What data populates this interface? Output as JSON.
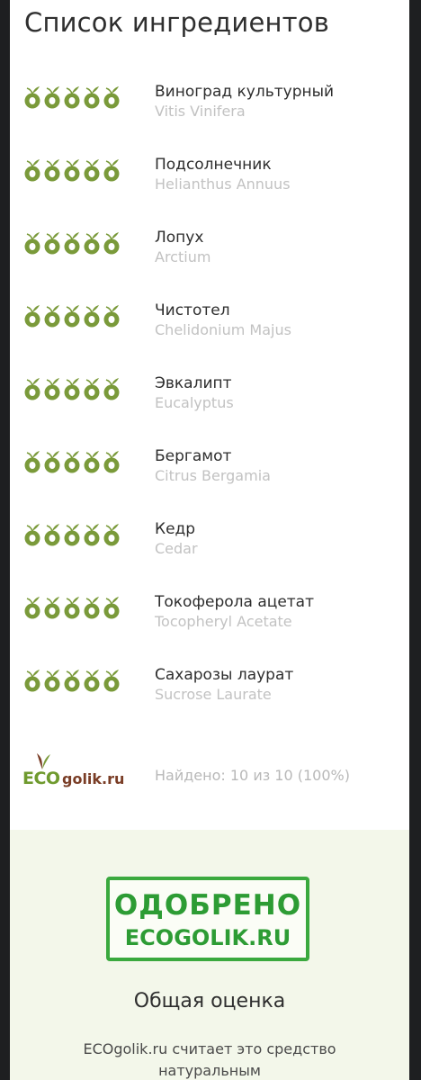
{
  "page": {
    "title": "Список ингредиентов"
  },
  "colors": {
    "accent_green": "#7a9a3a",
    "approve_green": "#2d9c34",
    "muted_gray": "#c2c2c2",
    "approve_bg": "#f3f7ea"
  },
  "ingredients": [
    {
      "name": "Виноград культурный",
      "latin": "Vitis Vinifera",
      "rating": 5
    },
    {
      "name": "Подсолнечник",
      "latin": "Helianthus Annuus",
      "rating": 5
    },
    {
      "name": "Лопух",
      "latin": "Arctium",
      "rating": 5
    },
    {
      "name": "Чистотел",
      "latin": "Chelidonium Majus",
      "rating": 5
    },
    {
      "name": "Эвкалипт",
      "latin": "Eucalyptus",
      "rating": 5
    },
    {
      "name": "Бергамот",
      "latin": "Citrus Bergamia",
      "rating": 5
    },
    {
      "name": "Кедр",
      "latin": "Cedar",
      "rating": 5
    },
    {
      "name": "Токоферола ацетат",
      "latin": "Tocopheryl Acetate",
      "rating": 5
    },
    {
      "name": "Сахарозы лаурат",
      "latin": "Sucrose Laurate",
      "rating": 5
    }
  ],
  "rating_icon": "olive-icon",
  "footer": {
    "logo_eco": "ECO",
    "logo_rest": "golik.ru",
    "found_text": "Найдено: 10 из 10 (100%)"
  },
  "approval": {
    "stamp_line1": "ОДОБРЕНО",
    "stamp_line2": "ECOGOLIK.RU",
    "overall_label": "Общая оценка",
    "verdict_line1": "ECOgolik.ru считает это средство",
    "verdict_line2": "натуральным"
  }
}
